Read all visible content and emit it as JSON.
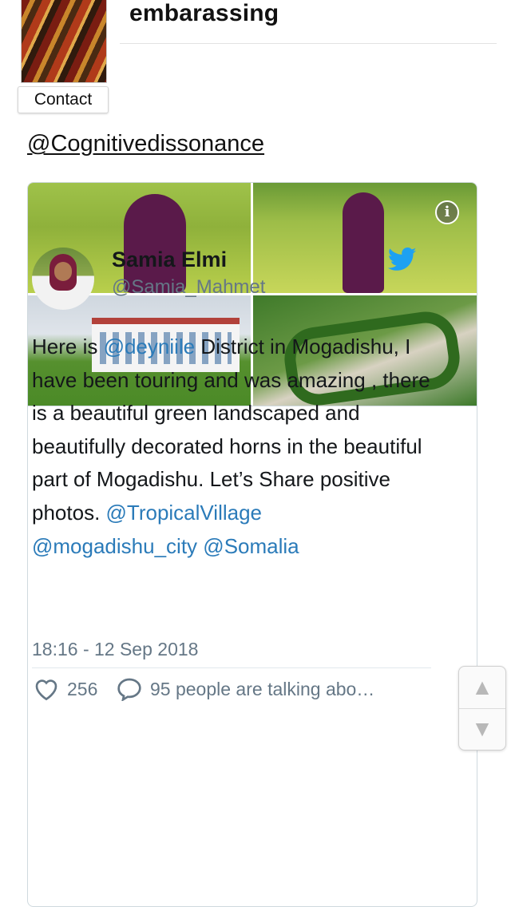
{
  "post": {
    "title": "embarassing",
    "contact_label": "Contact",
    "user_handle": "@Cognitivedissonance"
  },
  "tweet": {
    "name": "Samia Elmi",
    "handle": "@Samia_Mahmet",
    "text_parts": {
      "p1": "Here is ",
      "m1": "@deyniile",
      "p2": " District in Mogadishu, I have been touring and was amazing , there is a beautiful green landscaped and beautifully decorated horns in the beautiful part of Mogadishu. Let’s Share positive photos. ",
      "m2": "@TropicalVillage",
      "p3": " ",
      "m3": "@mogadishu_city",
      "p4": " ",
      "m4": "@Somalia"
    },
    "timestamp": "18:16 - 12 Sep 2018",
    "likes": "256",
    "talking": "95 people are talking abo…"
  },
  "icons": {
    "info": "info-icon",
    "bird": "twitter-bird-icon",
    "heart": "heart-icon",
    "reply": "reply-icon",
    "up": "arrow-up-icon",
    "down": "arrow-down-icon"
  },
  "colors": {
    "mention": "#2b7bb9",
    "twitter_blue": "#1da1f2",
    "meta_gray": "#657786"
  },
  "scroll": {
    "up_glyph": "▲",
    "down_glyph": "▼"
  },
  "info_glyph": "i"
}
